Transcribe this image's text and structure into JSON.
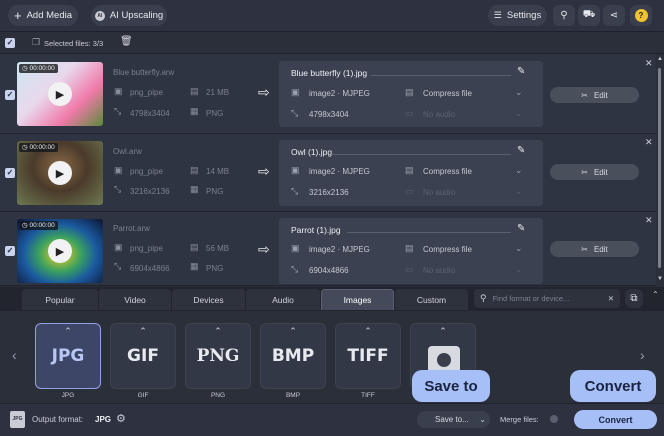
{
  "toolbar": {
    "add_media": "Add Media",
    "ai_upscaling": "AI Upscaling",
    "settings": "Settings"
  },
  "selection": {
    "label": "Selected files:",
    "count": "3/3"
  },
  "files": [
    {
      "duration": "00:00:00",
      "name": "Blue butterfly.arw",
      "codec": "png_pipe",
      "size": "21 MB",
      "resolution": "4798x3404",
      "format": "PNG",
      "output": {
        "name": "Blue butterfly (1).jpg",
        "codec": "image2 · MJPEG",
        "compress": "Compress file",
        "resolution": "4798x3404",
        "audio": "No audio"
      }
    },
    {
      "duration": "00:00:00",
      "name": "Owl.arw",
      "codec": "png_pipe",
      "size": "14 MB",
      "resolution": "3216x2136",
      "format": "PNG",
      "output": {
        "name": "Owl (1).jpg",
        "codec": "image2 · MJPEG",
        "compress": "Compress file",
        "resolution": "3216x2136",
        "audio": "No audio"
      }
    },
    {
      "duration": "00:00:00",
      "name": "Parrot.arw",
      "codec": "png_pipe",
      "size": "56 MB",
      "resolution": "6904x4866",
      "format": "PNG",
      "output": {
        "name": "Parrot (1).jpg",
        "codec": "image2 · MJPEG",
        "compress": "Compress file",
        "resolution": "6904x4866",
        "audio": "No audio"
      }
    }
  ],
  "edit_label": "Edit",
  "tabs": [
    "Popular",
    "Video",
    "Devices",
    "Audio",
    "Images",
    "Custom"
  ],
  "active_tab": "Images",
  "search_placeholder": "Find format or device...",
  "formats": [
    {
      "logo": "JPG",
      "label": "JPG"
    },
    {
      "logo": "GIF",
      "label": "GIF"
    },
    {
      "logo": "PNG",
      "label": "PNG"
    },
    {
      "logo": "BMP",
      "label": "BMP"
    },
    {
      "logo": "TIFF",
      "label": "TIFF"
    }
  ],
  "footer": {
    "output_format_label": "Output format:",
    "output_format_value": "JPG",
    "save_to": "Save to...",
    "merge_files": "Merge files:",
    "convert": "Convert"
  },
  "callouts": {
    "save_to": "Save to",
    "convert": "Convert"
  },
  "colors": {
    "accent": "#a7bff7",
    "selected_format": "#8ea0e6"
  }
}
